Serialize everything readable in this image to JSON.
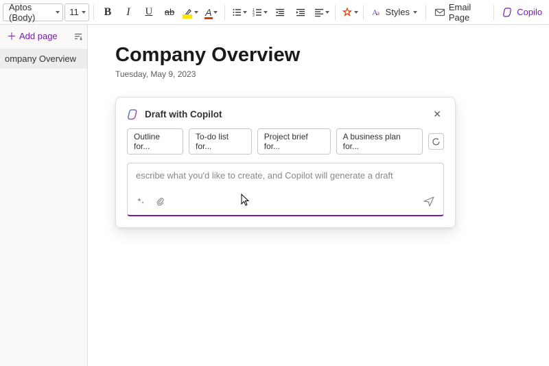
{
  "toolbar": {
    "font_name": "Aptos (Body)",
    "font_size": "11",
    "bold": "B",
    "italic": "I",
    "underline": "U",
    "strike": "ab",
    "highlight_letter": "",
    "font_color_letter": "A",
    "styles_label": "Styles",
    "email_label": "Email Page",
    "copilot_label": "Copilo"
  },
  "sidebar": {
    "add_page": "Add page",
    "items": [
      {
        "label": "ompany Overview"
      }
    ]
  },
  "page": {
    "title": "Company Overview",
    "date": "Tuesday, May 9, 2023"
  },
  "copilot": {
    "title": "Draft with Copilot",
    "suggestions": [
      "Outline for...",
      "To-do list for...",
      "Project brief for...",
      "A business plan for..."
    ],
    "placeholder": "escribe what you'd like to create, and Copilot will generate a draft"
  }
}
